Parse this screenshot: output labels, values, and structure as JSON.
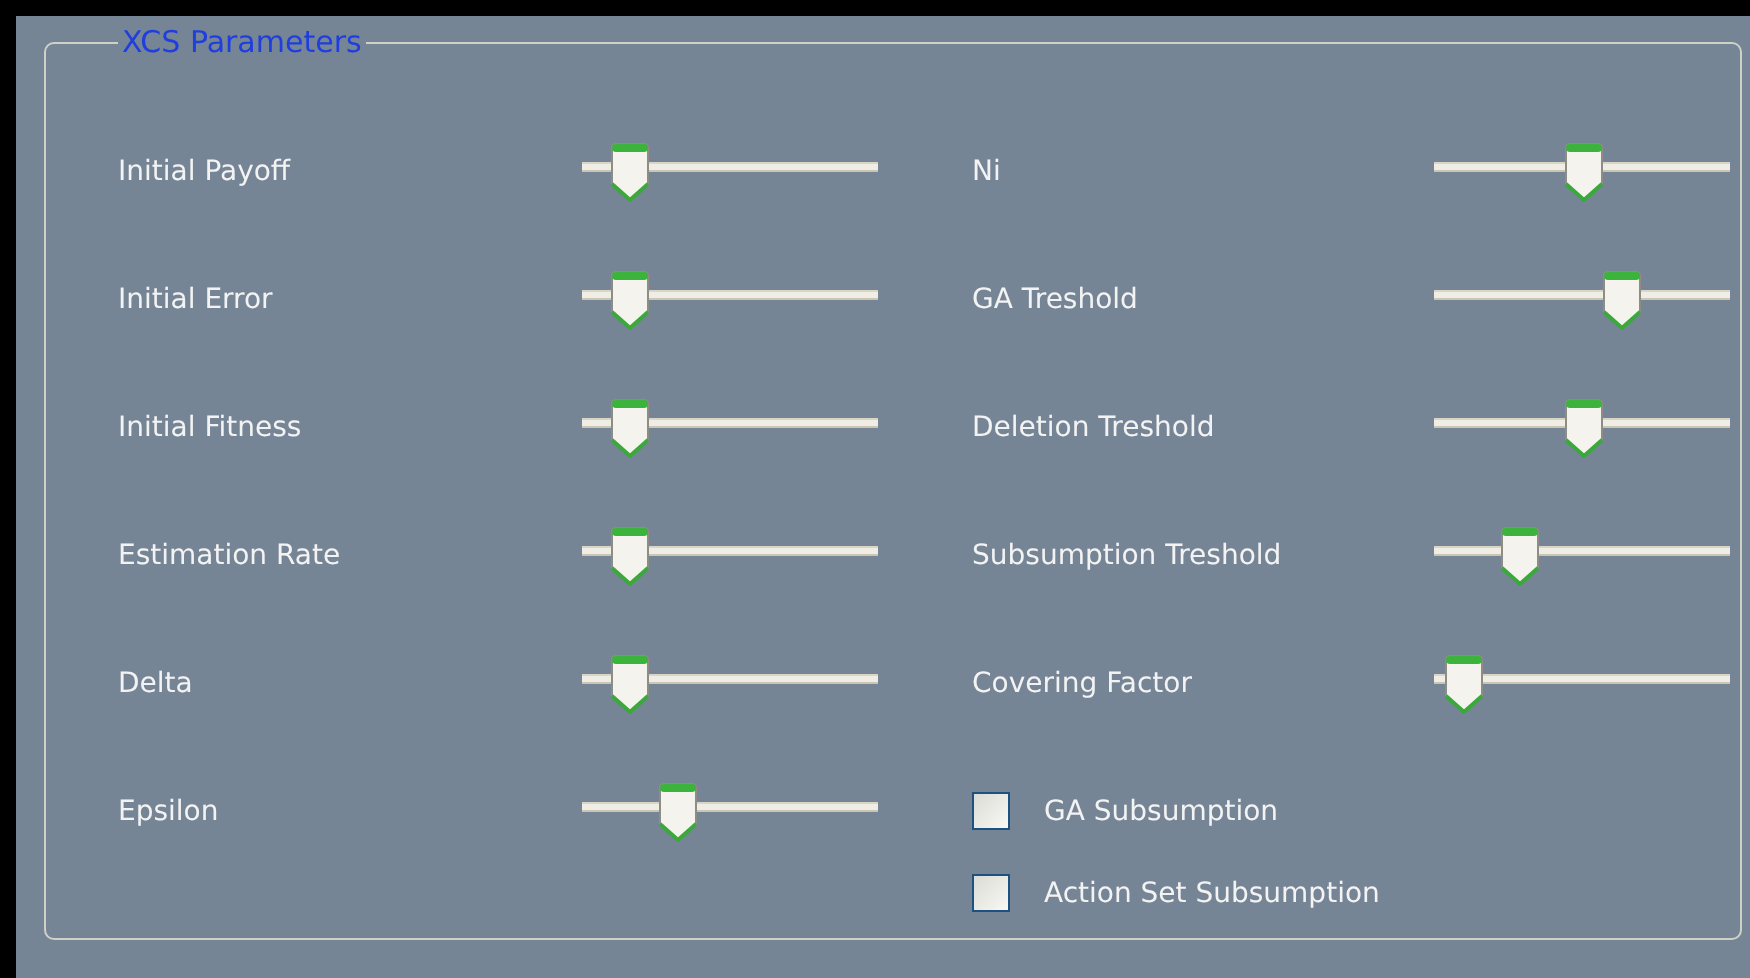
{
  "group": {
    "title": "XCS Parameters"
  },
  "left_sliders": [
    {
      "label": "Initial Payoff",
      "level": 0.1
    },
    {
      "label": "Initial Error",
      "level": 0.1
    },
    {
      "label": "Initial Fitness",
      "level": 0.1
    },
    {
      "label": "Estimation Rate",
      "level": 0.1
    },
    {
      "label": "Delta",
      "level": 0.1
    },
    {
      "label": "Epsilon",
      "level": 0.29
    }
  ],
  "right_sliders": [
    {
      "label": "Ni",
      "level": 0.51
    },
    {
      "label": "GA Treshold",
      "level": 0.66
    },
    {
      "label": "Deletion Treshold",
      "level": 0.51
    },
    {
      "label": "Subsumption Treshold",
      "level": 0.25
    },
    {
      "label": "Covering Factor",
      "level": 0.03
    }
  ],
  "checkboxes": [
    {
      "label": "GA Subsumption",
      "checked": false
    },
    {
      "label": "Action Set Subsumption",
      "checked": false
    }
  ]
}
